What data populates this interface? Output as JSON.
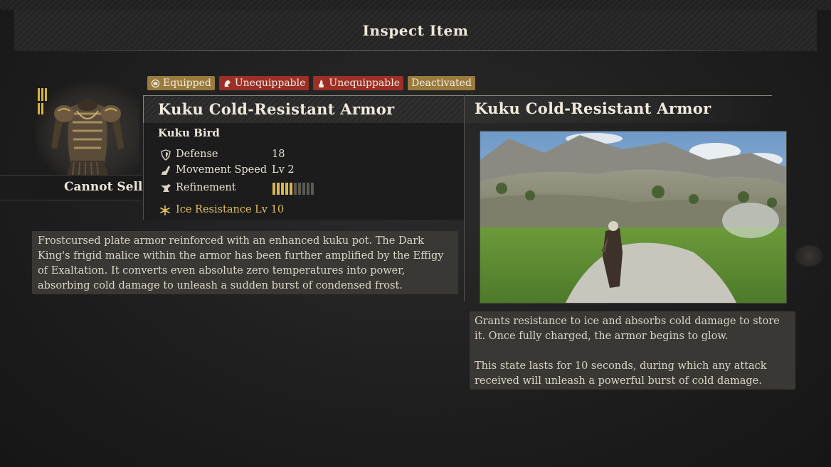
{
  "header": {
    "title": "Inspect Item"
  },
  "item": {
    "name": "Kuku Cold-Resistant Armor",
    "sell_status": "Cannot Sell",
    "set_name": "Kuku Bird",
    "badges": [
      {
        "label": "Equipped",
        "icon": "helmet-icon",
        "color": "#9a7a3d"
      },
      {
        "label": "Unequippable",
        "icon": "hood-icon",
        "color": "#9d2f26"
      },
      {
        "label": "Unequippable",
        "icon": "flame-hand-icon",
        "color": "#9d2f26"
      },
      {
        "label": "Deactivated",
        "color": "#9a7a3d"
      }
    ],
    "stats": [
      {
        "label": "Defense",
        "value": "18",
        "icon": "shield-icon"
      },
      {
        "label": "Movement Speed",
        "value": "Lv 2",
        "icon": "boot-icon"
      },
      {
        "label": "Refinement",
        "icon": "anvil-icon",
        "refinement_level": 5,
        "refinement_max": 10
      }
    ],
    "effect": {
      "label": "Ice Resistance Lv 10",
      "icon": "snowflake-icon",
      "color": "#e4bf62"
    },
    "description": "Frostcursed plate armor reinforced with an enhanced kuku pot. The Dark King's frigid malice within the armor has been further amplified by the Effigy of Exaltation. It converts even absolute zero temperatures into power, absorbing cold damage to unleash a sudden burst of condensed frost."
  },
  "preview": {
    "title": "Kuku Cold-Resistant Armor",
    "paragraphs": [
      "Grants resistance to ice and absorbs cold damage to store it. Once fully charged, the armor begins to glow.",
      "This state lasts for 10 seconds, during which any attack received will unleash a powerful burst of cold damage."
    ]
  }
}
